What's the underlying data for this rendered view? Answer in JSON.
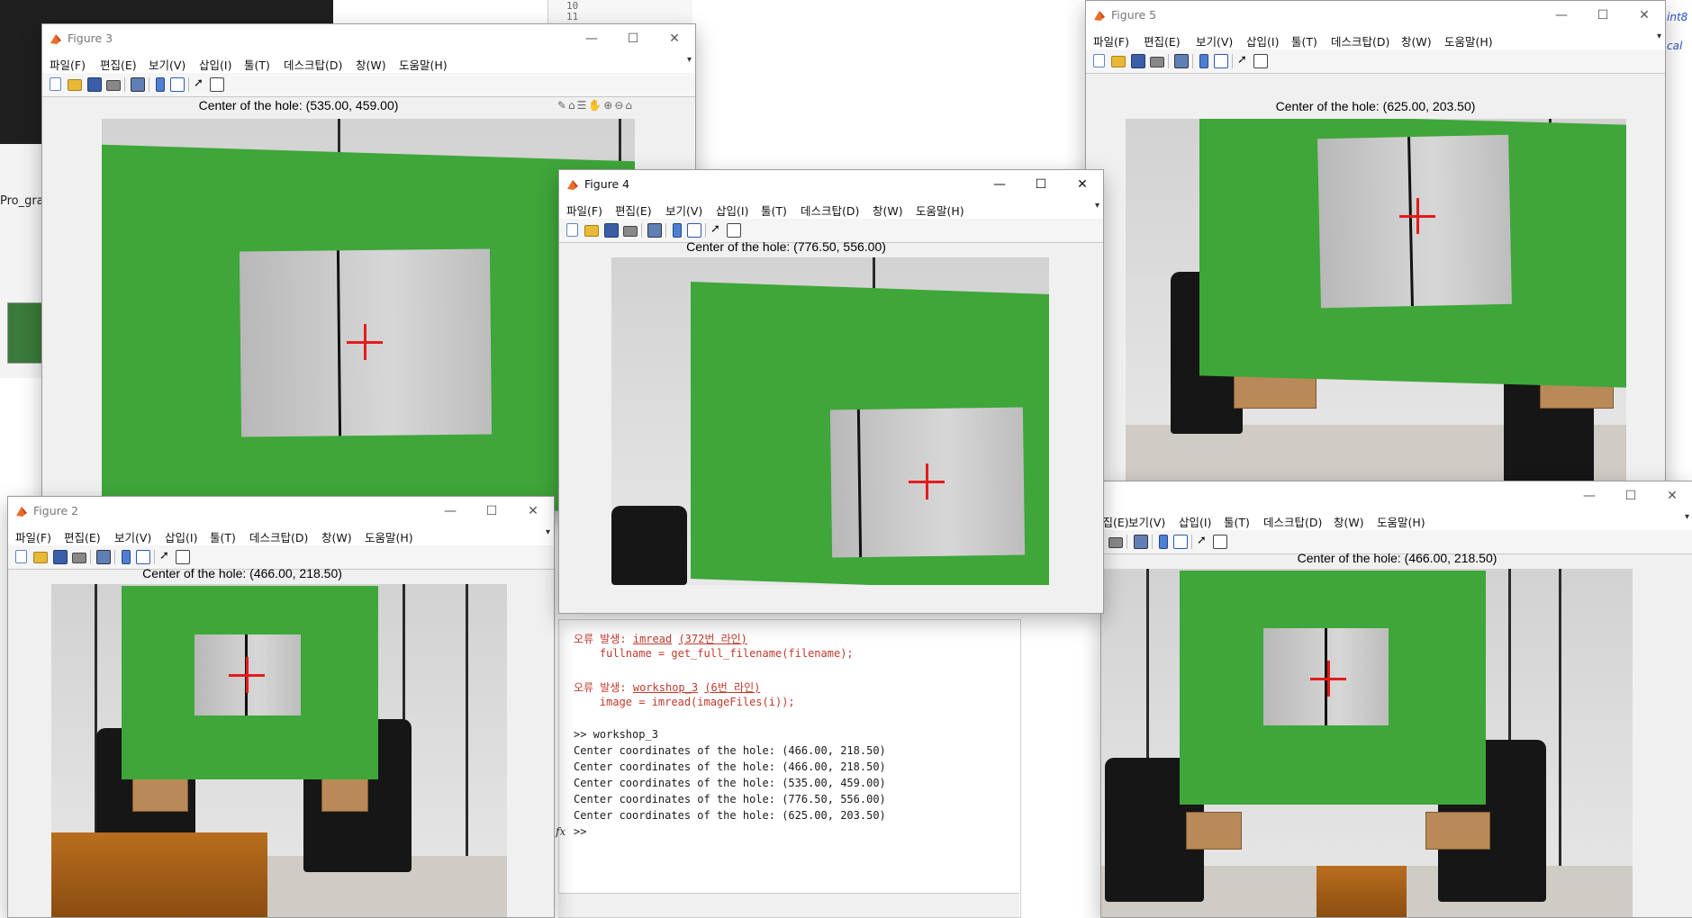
{
  "desktop": {
    "left_label": "Pro_gra",
    "editor_lines": [
      "10",
      "11"
    ],
    "right_edge": [
      "int8",
      "cal"
    ]
  },
  "window_controls": {
    "minimize": "—",
    "maximize": "☐",
    "close": "✕"
  },
  "menu_items": [
    "파일(F)",
    "편집(E)",
    "보기(V)",
    "삽입(I)",
    "툴(T)",
    "데스크탑(D)",
    "창(W)",
    "도움말(H)"
  ],
  "figures": {
    "fig3": {
      "title": "Figure 3",
      "caption": "Center of the hole: (535.00, 459.00)"
    },
    "fig4": {
      "title": "Figure 4",
      "caption": "Center of the hole: (776.50, 556.00)"
    },
    "fig5": {
      "title": "Figure 5",
      "caption": "Center of the hole: (625.00, 203.50)"
    },
    "fig2": {
      "title": "Figure 2",
      "caption": "Center of the hole: (466.00, 218.50)"
    },
    "fig1": {
      "caption": "Center of the hole: (466.00, 218.50)"
    }
  },
  "command_window": {
    "err1_prefix": "오류 발생: ",
    "err1_fn": "imread",
    "err1_line": "(372번 라인)",
    "err1_code": "    fullname = get_full_filename(filename);",
    "err2_prefix": "오류 발생: ",
    "err2_fn": "workshop_3",
    "err2_line": "(6번 라인)",
    "err2_code": "    image = imread(imageFiles(i));",
    "command": ">> workshop_3",
    "outputs": [
      "Center coordinates of the hole: (466.00, 218.50)",
      "Center coordinates of the hole: (466.00, 218.50)",
      "Center coordinates of the hole: (535.00, 459.00)",
      "Center coordinates of the hole: (776.50, 556.00)",
      "Center coordinates of the hole: (625.00, 203.50)"
    ],
    "fx": "fx",
    "prompt": ">>"
  }
}
